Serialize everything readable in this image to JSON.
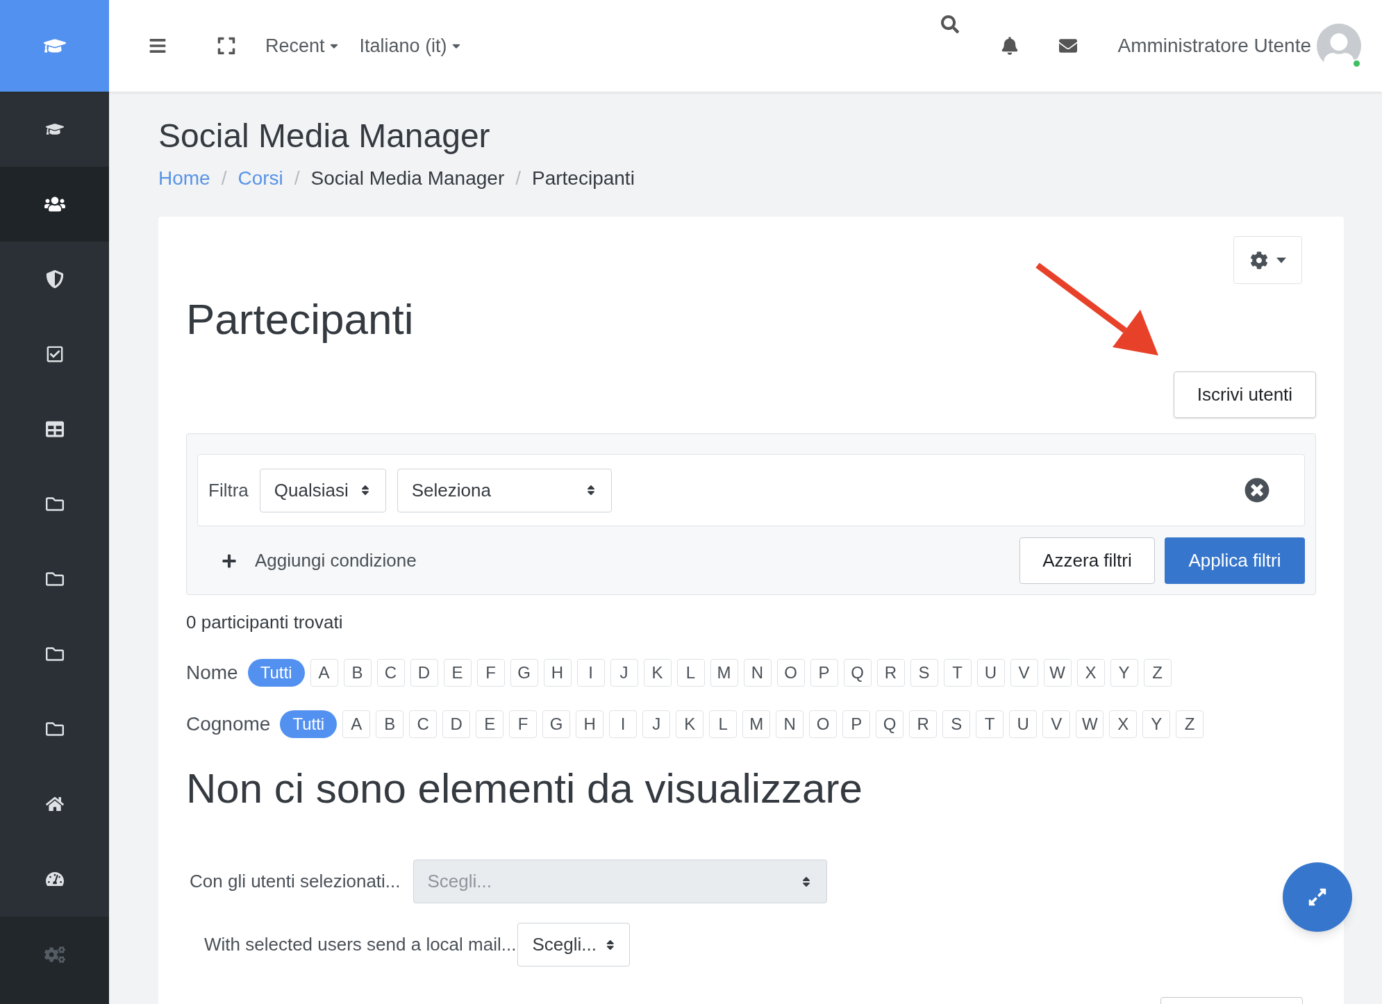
{
  "header": {
    "nav_menus": [
      {
        "label": "Recent"
      },
      {
        "label": "Italiano (it)"
      }
    ],
    "user_name": "Amministratore Utente",
    "online": true
  },
  "sidebar": {
    "items": [
      {
        "kind": "graduation-cap",
        "selected": false
      },
      {
        "kind": "users",
        "selected": true
      },
      {
        "kind": "shield",
        "selected": false
      },
      {
        "kind": "checkbox",
        "selected": false
      },
      {
        "kind": "table",
        "selected": false
      },
      {
        "kind": "folder",
        "selected": false
      },
      {
        "kind": "folder",
        "selected": false
      },
      {
        "kind": "folder",
        "selected": false
      },
      {
        "kind": "folder",
        "selected": false
      },
      {
        "kind": "home",
        "selected": false
      },
      {
        "kind": "dashboard",
        "selected": false
      }
    ],
    "footer_item": {
      "kind": "cogs"
    }
  },
  "page_title": "Social Media Manager",
  "breadcrumb": [
    {
      "label": "Home",
      "link": true
    },
    {
      "separator": "/"
    },
    {
      "label": "Corsi",
      "link": true
    },
    {
      "separator": "/"
    },
    {
      "label": "Social Media Manager",
      "link": false
    },
    {
      "separator": "/"
    },
    {
      "label": "Partecipanti",
      "link": false
    }
  ],
  "heading": "Partecipanti",
  "enrol_button": "Iscrivi utenti",
  "filter": {
    "label": "Filtra",
    "match_select": "Qualsiasi",
    "type_select": "Seleziona",
    "add_condition": "Aggiungi condizione",
    "reset_button": "Azzera filtri",
    "apply_button": "Applica filtri"
  },
  "result_count": "0 participanti trovati",
  "initials_bars": [
    {
      "label": "Nome",
      "letters": [
        {
          "label": "Tutti",
          "selected": true
        },
        {
          "label": "A",
          "selected": false
        },
        {
          "label": "B",
          "selected": false
        },
        {
          "label": "C",
          "selected": false
        },
        {
          "label": "D",
          "selected": false
        },
        {
          "label": "E",
          "selected": false
        },
        {
          "label": "F",
          "selected": false
        },
        {
          "label": "G",
          "selected": false
        },
        {
          "label": "H",
          "selected": false
        },
        {
          "label": "I",
          "selected": false
        },
        {
          "label": "J",
          "selected": false
        },
        {
          "label": "K",
          "selected": false
        },
        {
          "label": "L",
          "selected": false
        },
        {
          "label": "M",
          "selected": false
        },
        {
          "label": "N",
          "selected": false
        },
        {
          "label": "O",
          "selected": false
        },
        {
          "label": "P",
          "selected": false
        },
        {
          "label": "Q",
          "selected": false
        },
        {
          "label": "R",
          "selected": false
        },
        {
          "label": "S",
          "selected": false
        },
        {
          "label": "T",
          "selected": false
        },
        {
          "label": "U",
          "selected": false
        },
        {
          "label": "V",
          "selected": false
        },
        {
          "label": "W",
          "selected": false
        },
        {
          "label": "X",
          "selected": false
        },
        {
          "label": "Y",
          "selected": false
        },
        {
          "label": "Z",
          "selected": false
        }
      ]
    },
    {
      "label": "Cognome",
      "letters": [
        {
          "label": "Tutti",
          "selected": true
        },
        {
          "label": "A",
          "selected": false
        },
        {
          "label": "B",
          "selected": false
        },
        {
          "label": "C",
          "selected": false
        },
        {
          "label": "D",
          "selected": false
        },
        {
          "label": "E",
          "selected": false
        },
        {
          "label": "F",
          "selected": false
        },
        {
          "label": "G",
          "selected": false
        },
        {
          "label": "H",
          "selected": false
        },
        {
          "label": "I",
          "selected": false
        },
        {
          "label": "J",
          "selected": false
        },
        {
          "label": "K",
          "selected": false
        },
        {
          "label": "L",
          "selected": false
        },
        {
          "label": "M",
          "selected": false
        },
        {
          "label": "N",
          "selected": false
        },
        {
          "label": "O",
          "selected": false
        },
        {
          "label": "P",
          "selected": false
        },
        {
          "label": "Q",
          "selected": false
        },
        {
          "label": "R",
          "selected": false
        },
        {
          "label": "S",
          "selected": false
        },
        {
          "label": "T",
          "selected": false
        },
        {
          "label": "U",
          "selected": false
        },
        {
          "label": "V",
          "selected": false
        },
        {
          "label": "W",
          "selected": false
        },
        {
          "label": "X",
          "selected": false
        },
        {
          "label": "Y",
          "selected": false
        },
        {
          "label": "Z",
          "selected": false
        }
      ]
    }
  ],
  "empty_message": "Non ci sono elementi da visualizzare",
  "bulk_actions": [
    {
      "kind": "wide",
      "label": "Con gli utenti selezionati...",
      "value": "Scegli...",
      "disabled": true
    },
    {
      "kind": "compact",
      "label": "With selected users send a local mail...",
      "value": "Scegli...",
      "disabled": false
    }
  ]
}
